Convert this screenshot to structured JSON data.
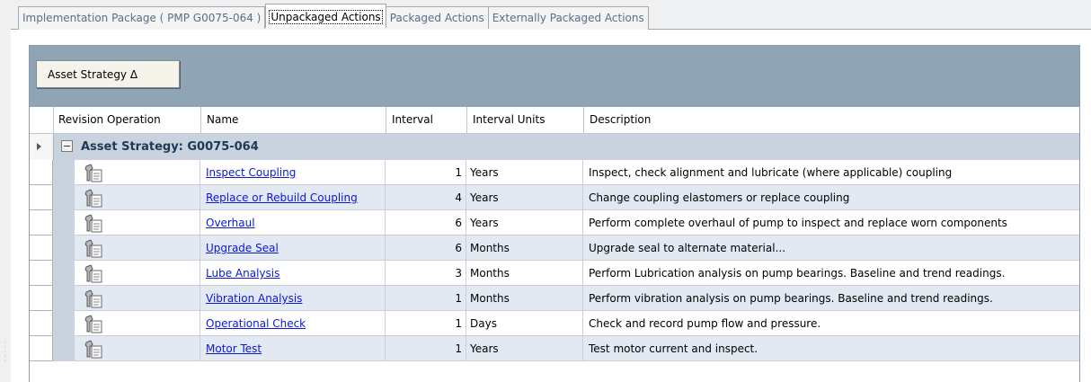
{
  "tabs": [
    {
      "label": "Implementation Package ( PMP G0075-064 )",
      "active": false
    },
    {
      "label": "Unpackaged Actions",
      "active": true
    },
    {
      "label": "Packaged Actions",
      "active": false
    },
    {
      "label": "Externally Packaged Actions",
      "active": false
    }
  ],
  "groupby": {
    "button_label": "Asset Strategy Δ"
  },
  "columns": {
    "revision_operation": "Revision Operation",
    "name": "Name",
    "interval": "Interval",
    "interval_units": "Interval Units",
    "description": "Description"
  },
  "group": {
    "label": "Asset Strategy: G0075-064",
    "expanded": true
  },
  "icons": {
    "row_operation": "revision-operation-icon"
  },
  "colors": {
    "link": "#0a18d8",
    "groupby_bar": "#8fa4b5",
    "group_row": "#c8d3df",
    "alt_row": "#e3e9f2"
  },
  "rows": [
    {
      "name": "Inspect Coupling",
      "interval": "1",
      "units": "Years",
      "description": "Inspect, check alignment and lubricate (where applicable) coupling"
    },
    {
      "name": "Replace or Rebuild Coupling",
      "interval": "4",
      "units": "Years",
      "description": "Change coupling elastomers or replace coupling"
    },
    {
      "name": "Overhaul",
      "interval": "6",
      "units": "Years",
      "description": "Perform complete overhaul of pump to inspect and replace worn components"
    },
    {
      "name": "Upgrade Seal",
      "interval": "6",
      "units": "Months",
      "description": "Upgrade seal to alternate material..."
    },
    {
      "name": "Lube Analysis",
      "interval": "3",
      "units": "Months",
      "description": "Perform Lubrication analysis on pump bearings.  Baseline and trend readings."
    },
    {
      "name": "Vibration Analysis",
      "interval": "1",
      "units": "Months",
      "description": "Perform vibration analysis on pump bearings.  Baseline and trend readings."
    },
    {
      "name": "Operational Check",
      "interval": "1",
      "units": "Days",
      "description": "Check and record pump flow and pressure."
    },
    {
      "name": "Motor Test",
      "interval": "1",
      "units": "Years",
      "description": "Test motor current and inspect."
    }
  ]
}
